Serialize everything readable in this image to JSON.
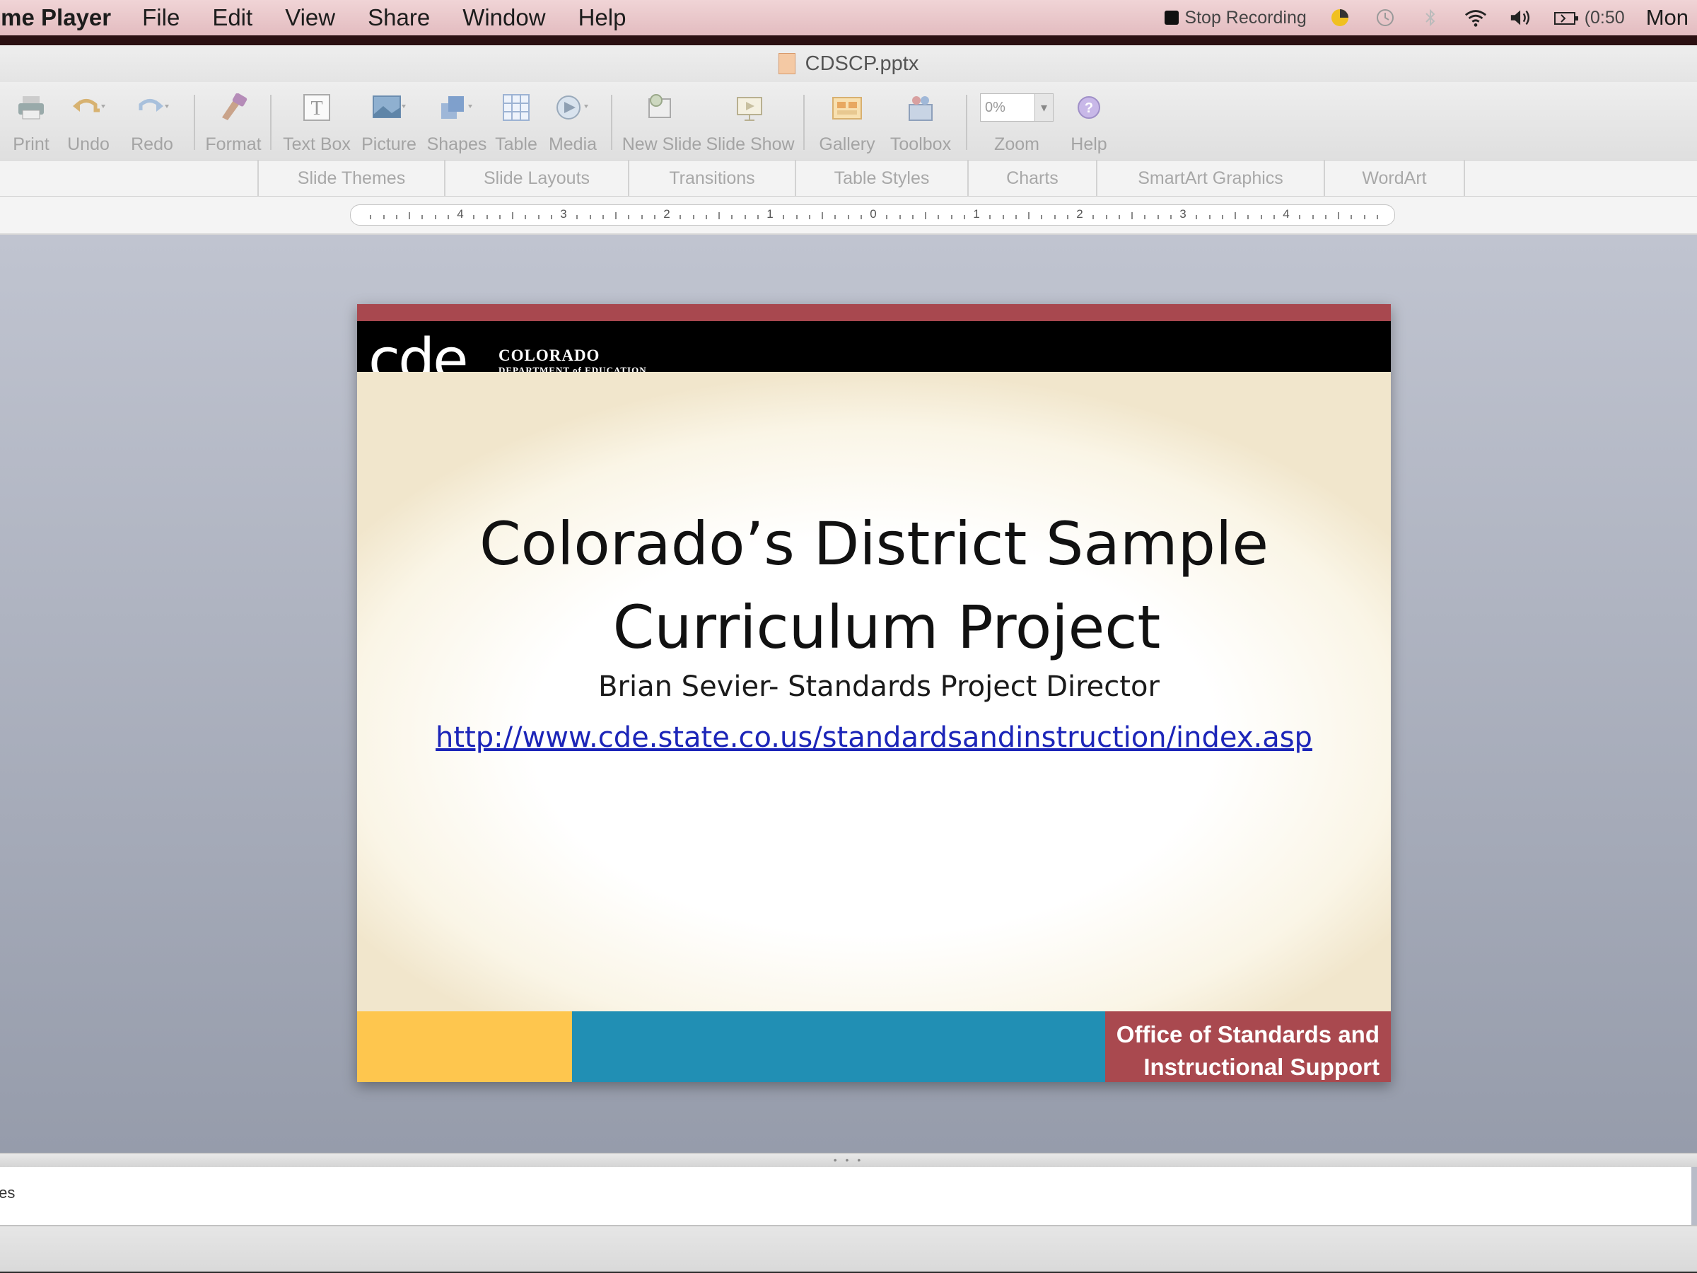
{
  "menubar": {
    "app_name": "ime Player",
    "menus": [
      "File",
      "Edit",
      "View",
      "Share",
      "Window",
      "Help"
    ],
    "stop_recording": "Stop Recording",
    "battery": "(0:50",
    "clock": "Mon"
  },
  "window": {
    "title": "CDSCP.pptx"
  },
  "toolbar": {
    "print": "Print",
    "undo": "Undo",
    "redo": "Redo",
    "format": "Format",
    "text_box": "Text Box",
    "picture": "Picture",
    "shapes": "Shapes",
    "table": "Table",
    "media": "Media",
    "new_slide": "New Slide",
    "slide_show": "Slide Show",
    "gallery": "Gallery",
    "toolbox": "Toolbox",
    "zoom": "Zoom",
    "zoom_value": "0%",
    "help": "Help"
  },
  "ribbon": {
    "tabs": [
      "Slide Themes",
      "Slide Layouts",
      "Transitions",
      "Table Styles",
      "Charts",
      "SmartArt Graphics",
      "WordArt"
    ]
  },
  "ruler": {
    "labels": [
      "4",
      "3",
      "2",
      "1",
      "0",
      "1",
      "2",
      "3",
      "4"
    ]
  },
  "slide": {
    "logo_text": "cde",
    "logo_state": "COLORADO",
    "logo_dept": "DEPARTMENT of EDUCATION",
    "title_line1": "Colorado’s District Sample",
    "title_line2": "Curriculum Project",
    "subtitle": "Brian Sevier- Standards Project Director",
    "link": "http://www.cde.state.co.us/standardsandinstruction/index.asp",
    "footer_line1": "Office of Standards and",
    "footer_line2": "Instructional Support",
    "colors": {
      "accent_red": "#a9494f",
      "yellow": "#fec64e",
      "blue": "#218fb4",
      "link": "#1c25b8"
    }
  },
  "notes": {
    "text": "tes"
  }
}
